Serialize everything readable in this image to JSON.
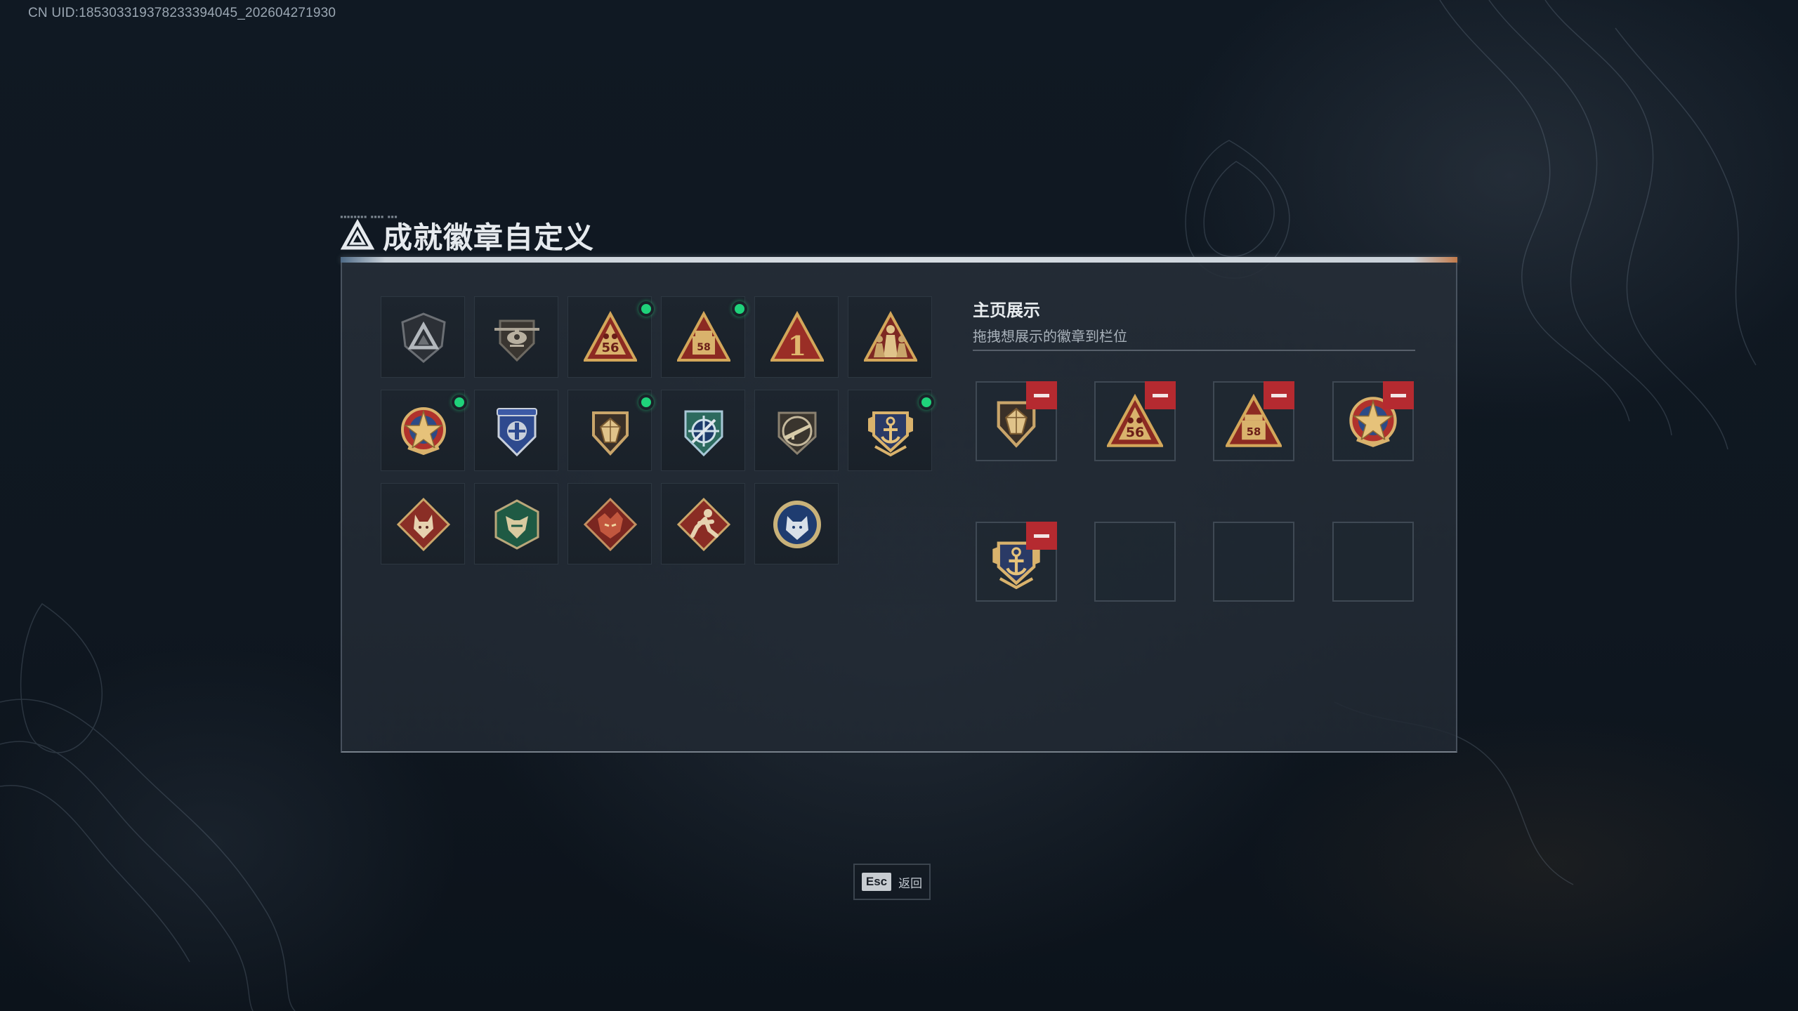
{
  "uid_text": "CN UID:18530331937823339404‌5_202604271930",
  "title": "成就徽章自定义",
  "showcase": {
    "title": "主页展示",
    "subtitle": "拖拽想展示的徽章到栏位"
  },
  "badges": [
    {
      "icon": "shield-triangle-icon",
      "new": false
    },
    {
      "icon": "helicopter-shield-icon",
      "new": false
    },
    {
      "icon": "triangle-56-icon",
      "new": true,
      "label": "56"
    },
    {
      "icon": "triangle-58-icon",
      "new": true,
      "label": "58"
    },
    {
      "icon": "triangle-number-one-icon",
      "new": false,
      "label": "1"
    },
    {
      "icon": "triangle-soldiers-icon",
      "new": false
    },
    {
      "icon": "star-medal-icon",
      "new": true
    },
    {
      "icon": "blue-eagle-shield-icon",
      "new": false
    },
    {
      "icon": "diamond-shield-icon",
      "new": true
    },
    {
      "icon": "crosshair-shield-icon",
      "new": false
    },
    {
      "icon": "rifle-shield-icon",
      "new": false
    },
    {
      "icon": "anchor-crest-icon",
      "new": true
    },
    {
      "icon": "wolf-diamond-icon",
      "new": false
    },
    {
      "icon": "green-beast-hexagon-icon",
      "new": false
    },
    {
      "icon": "red-dragon-diamond-icon",
      "new": false
    },
    {
      "icon": "runner-diamond-icon",
      "new": false
    },
    {
      "icon": "blue-wolf-circle-icon",
      "new": false
    }
  ],
  "slots": [
    {
      "icon": "diamond-shield-icon",
      "filled": true
    },
    {
      "icon": "triangle-56-icon",
      "filled": true,
      "label": "56"
    },
    {
      "icon": "triangle-58-icon",
      "filled": true,
      "label": "58"
    },
    {
      "icon": "star-medal-icon",
      "filled": true
    },
    {
      "icon": "anchor-crest-icon",
      "filled": true
    },
    {
      "filled": false
    },
    {
      "filled": false
    },
    {
      "filled": false
    }
  ],
  "back": {
    "key": "Esc",
    "label": "返回"
  },
  "colors": {
    "accent_new": "#1fd27a",
    "remove": "#b52a30",
    "panel": "#262e38"
  }
}
